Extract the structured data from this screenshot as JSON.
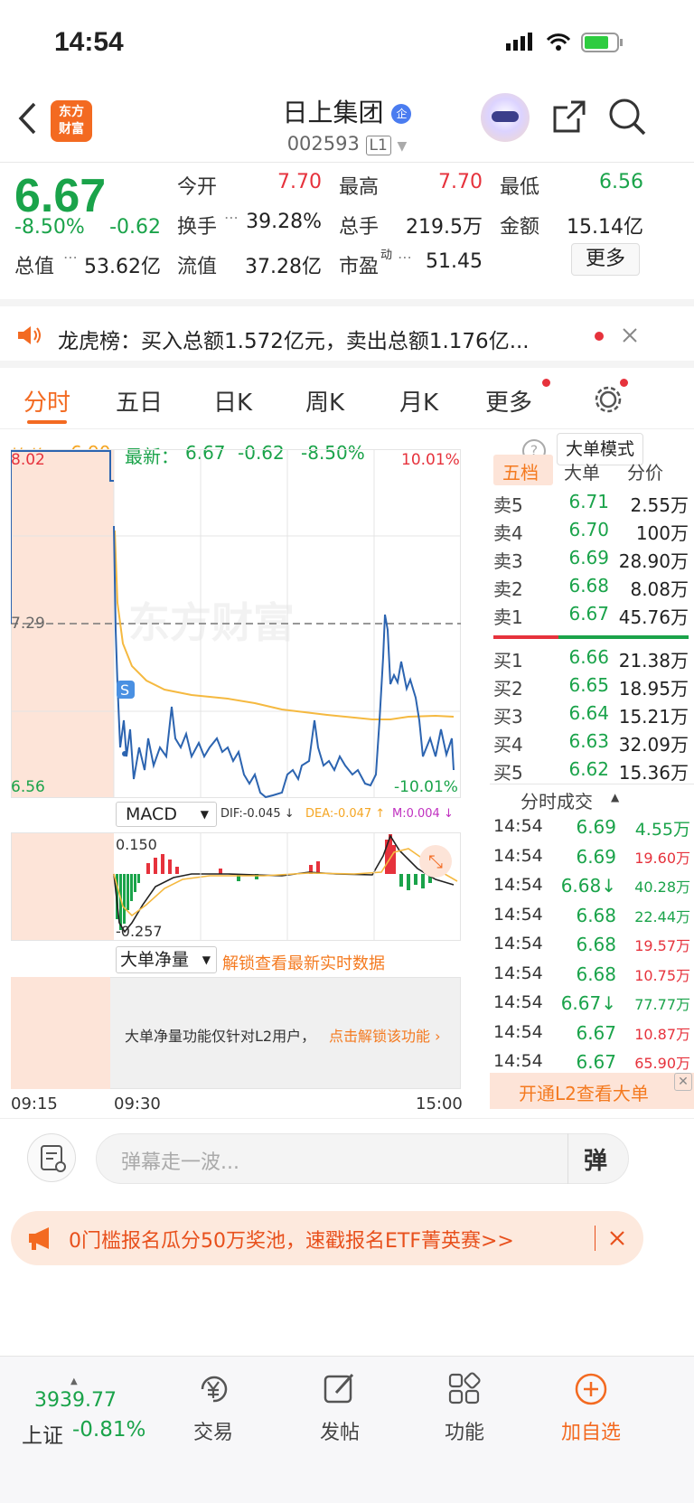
{
  "status": {
    "time": "14:54"
  },
  "header": {
    "title": "日上集团",
    "badge": "企",
    "code": "002593",
    "level": "L1",
    "logo_line1": "东方",
    "logo_line2": "财富"
  },
  "quote": {
    "price": "6.67",
    "pct": "-8.50%",
    "chg": "-0.62",
    "open_label": "今开",
    "open": "7.70",
    "high_label": "最高",
    "high": "7.70",
    "low_label": "最低",
    "low": "6.56",
    "turnover_label": "换手",
    "turnover": "39.28%",
    "vol_label": "总手",
    "vol": "219.5万",
    "amt_label": "金额",
    "amt": "15.14亿",
    "mcap_label": "总值",
    "mcap": "53.62亿",
    "float_label": "流值",
    "float": "37.28亿",
    "pe_label": "市盈",
    "pe_sup": "动",
    "pe": "51.45",
    "more": "更多"
  },
  "notice": {
    "text": "龙虎榜：买入总额1.572亿元，卖出总额1.176亿..."
  },
  "tabs": [
    "分时",
    "五日",
    "日K",
    "周K",
    "月K",
    "更多"
  ],
  "avg": {
    "avg_label": "均价：",
    "avg": "6.90",
    "latest_label": "最新：",
    "latest": "6.67",
    "chg": "-0.62",
    "pct": "-8.50%",
    "mode": "大单模式"
  },
  "chart": {
    "ymax": "8.02",
    "ymid": "7.29",
    "ymin": "6.56",
    "pmax": "10.01%",
    "pmin": "-10.01%",
    "s_marker": "S",
    "macd_label": "MACD",
    "dif": "DIF:-0.045 ↓",
    "dea": "DEA:-0.047 ↑",
    "m": "M:0.004 ↓",
    "macd_hi": "0.150",
    "macd_lo": "-0.257",
    "big_label": "大单净量",
    "unlock": "解锁查看最新实时数据",
    "l2_msg": "大单净量功能仅针对L2用户，",
    "l2_link": "点击解锁该功能",
    "t1": "09:15",
    "t2": "09:30",
    "t3": "15:00",
    "watermark": "东方财富"
  },
  "panel": {
    "tabs": [
      "五档",
      "大单",
      "分价"
    ],
    "asks": [
      {
        "l": "卖5",
        "p": "6.71",
        "v": "2.55万"
      },
      {
        "l": "卖4",
        "p": "6.70",
        "v": "100万"
      },
      {
        "l": "卖3",
        "p": "6.69",
        "v": "28.90万"
      },
      {
        "l": "卖2",
        "p": "6.68",
        "v": "8.08万"
      },
      {
        "l": "卖1",
        "p": "6.67",
        "v": "45.76万"
      }
    ],
    "bids": [
      {
        "l": "买1",
        "p": "6.66",
        "v": "21.38万"
      },
      {
        "l": "买2",
        "p": "6.65",
        "v": "18.95万"
      },
      {
        "l": "买3",
        "p": "6.64",
        "v": "15.21万"
      },
      {
        "l": "买4",
        "p": "6.63",
        "v": "32.09万"
      },
      {
        "l": "买5",
        "p": "6.62",
        "v": "15.36万"
      }
    ],
    "ticks_title": "分时成交",
    "ticks": [
      {
        "t": "14:54",
        "p": "6.69",
        "v": "4.55万",
        "c": "green"
      },
      {
        "t": "14:54",
        "p": "6.69",
        "v": "19.60万",
        "c": "red"
      },
      {
        "t": "14:54",
        "p": "6.68↓",
        "v": "40.28万",
        "c": "green"
      },
      {
        "t": "14:54",
        "p": "6.68",
        "v": "22.44万",
        "c": "green"
      },
      {
        "t": "14:54",
        "p": "6.68",
        "v": "19.57万",
        "c": "red"
      },
      {
        "t": "14:54",
        "p": "6.68",
        "v": "10.75万",
        "c": "red"
      },
      {
        "t": "14:54",
        "p": "6.67↓",
        "v": "77.77万",
        "c": "green"
      },
      {
        "t": "14:54",
        "p": "6.67",
        "v": "10.87万",
        "c": "red"
      },
      {
        "t": "14:54",
        "p": "6.67",
        "v": "65.90万",
        "c": "red"
      }
    ],
    "l2": "开通L2查看大单"
  },
  "comment": {
    "placeholder": "弹幕走一波...",
    "btn": "弹"
  },
  "banner": {
    "text": "0门槛报名瓜分50万奖池，速戳报名ETF菁英赛>>"
  },
  "footer": {
    "index": "3939.77",
    "index_name": "上证",
    "index_pct": "-0.81%",
    "trade": "交易",
    "post": "发帖",
    "func": "功能",
    "add": "加自选"
  }
}
